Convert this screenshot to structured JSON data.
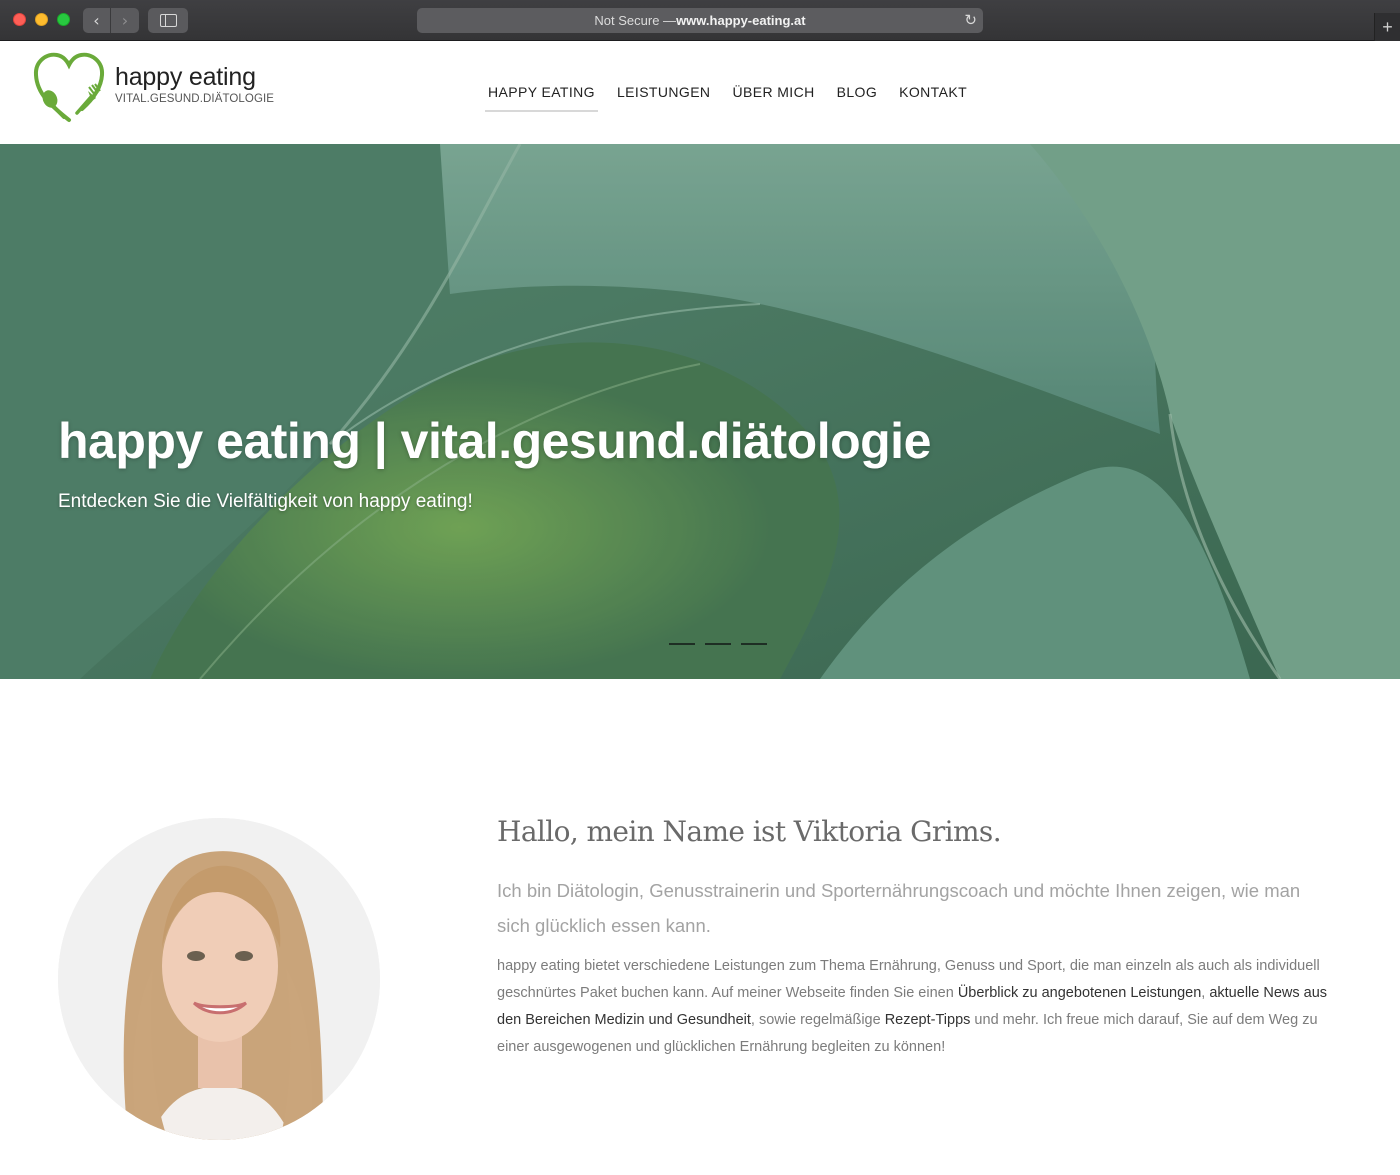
{
  "browser": {
    "url_prefix": "Not Secure — ",
    "url_host": "www.happy-eating.at",
    "back_icon": "‹",
    "forward_icon": "›",
    "reload_icon": "↻",
    "new_tab_icon": "+"
  },
  "header": {
    "logo_name": "happy eating",
    "logo_tagline": "VITAL.GESUND.DIÄTOLOGIE",
    "brand_color": "#6aaa3a",
    "nav": [
      {
        "label": "HAPPY EATING",
        "active": true
      },
      {
        "label": "LEISTUNGEN",
        "active": false
      },
      {
        "label": "ÜBER MICH",
        "active": false
      },
      {
        "label": "BLOG",
        "active": false
      },
      {
        "label": "KONTAKT",
        "active": false
      }
    ]
  },
  "hero": {
    "title": "happy eating | vital.gesund.diätologie",
    "subtitle": "Entdecken Sie die Vielfältigkeit von happy eating!",
    "slide_count": 3
  },
  "about": {
    "title": "Hallo, mein Name ist Viktoria Grims.",
    "lead": "Ich bin Diätologin, Genusstrainerin und Sporternährungscoach und möchte Ihnen zeigen, wie man sich glücklich essen kann.",
    "body_1": "happy eating bietet verschiedene Leistungen zum Thema Ernährung, Genuss und Sport, die man einzeln als auch als individuell geschnürtes Paket buchen kann. Auf meiner Webseite finden Sie einen ",
    "link_1": "Überblick zu angebotenen Leistungen",
    "body_2": ", ",
    "link_2": "aktuelle News aus den Bereichen Medizin und Gesundheit",
    "body_3": ", sowie regelmäßige ",
    "link_3": "Rezept-Tipps",
    "body_4": " und mehr. Ich freue mich darauf, Sie auf dem Weg zu einer ausgewogenen und glücklichen Ernährung begleiten zu können!"
  }
}
